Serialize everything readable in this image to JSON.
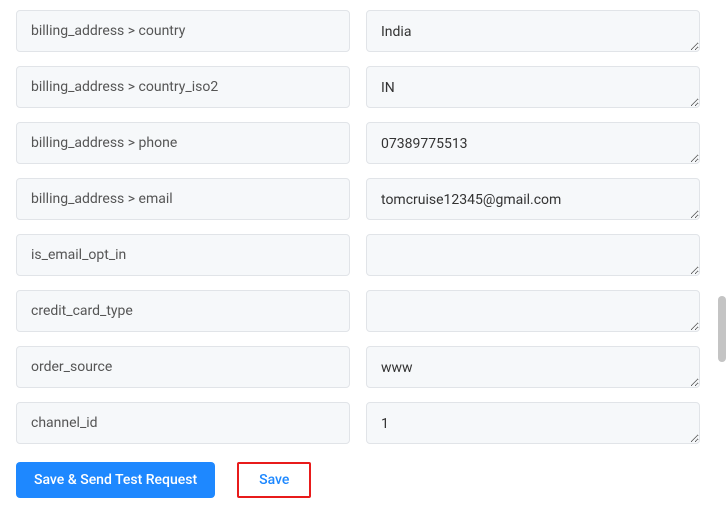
{
  "rows": [
    {
      "key": "billing_address > country",
      "value": "India"
    },
    {
      "key": "billing_address > country_iso2",
      "value": "IN"
    },
    {
      "key": "billing_address > phone",
      "value": "07389775513"
    },
    {
      "key": "billing_address > email",
      "value": "tomcruise12345@gmail.com"
    },
    {
      "key": "is_email_opt_in",
      "value": ""
    },
    {
      "key": "credit_card_type",
      "value": ""
    },
    {
      "key": "order_source",
      "value": "www"
    },
    {
      "key": "channel_id",
      "value": "1"
    }
  ],
  "actions": {
    "save_send_label": "Save & Send Test Request",
    "save_label": "Save"
  }
}
